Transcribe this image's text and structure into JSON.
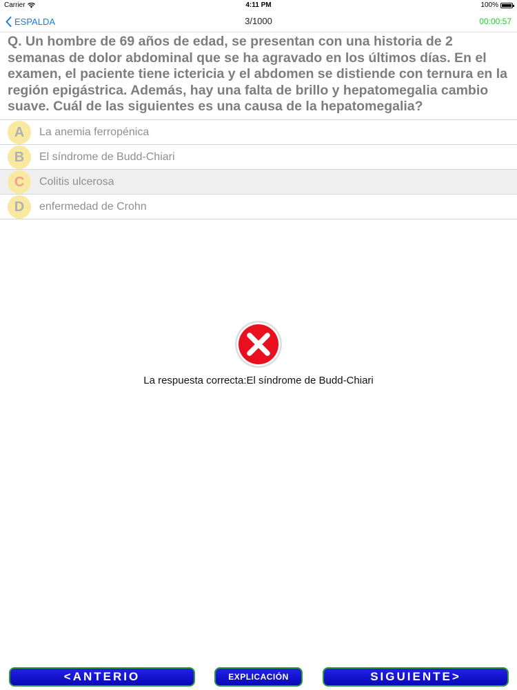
{
  "status_bar": {
    "carrier": "Carrier",
    "time": "4:11 PM",
    "battery": "100%"
  },
  "nav": {
    "back_label": "ESPALDA",
    "title": "3/1000",
    "timer": "00:00:57"
  },
  "question": {
    "text": "Q. Un hombre de 69 años de edad, se presentan con una historia de 2 semanas de dolor abdominal que se ha agravado en los últimos días. En el examen, el paciente tiene ictericia y el abdomen se distiende con ternura en la región epigástrica. Además, hay una falta de brillo y hepatomegalia cambio suave. Cuál de las siguientes es una causa de la hepatomegalia?"
  },
  "options": [
    {
      "letter": "A",
      "text": "La anemia ferropénica"
    },
    {
      "letter": "B",
      "text": "El síndrome de Budd-Chiari"
    },
    {
      "letter": "C",
      "text": "Colitis ulcerosa"
    },
    {
      "letter": "D",
      "text": "enfermedad de Crohn"
    }
  ],
  "selected_option": "C",
  "result": {
    "icon": "wrong-x-icon",
    "text": "La respuesta correcta:El síndrome de Budd-Chiari"
  },
  "buttons": {
    "prev_label": "<ANTERIO",
    "explanation_label": "EXPLICACIÓN",
    "next_label": "SIGUIENTE>"
  },
  "colors": {
    "accent_blue": "#1a7ae8",
    "timer_green": "#1bd02a",
    "button_blue": "#1010d0",
    "button_border": "#2e9a38",
    "wrong_red": "#e8101e",
    "letter_circle": "#f8e8a0"
  }
}
